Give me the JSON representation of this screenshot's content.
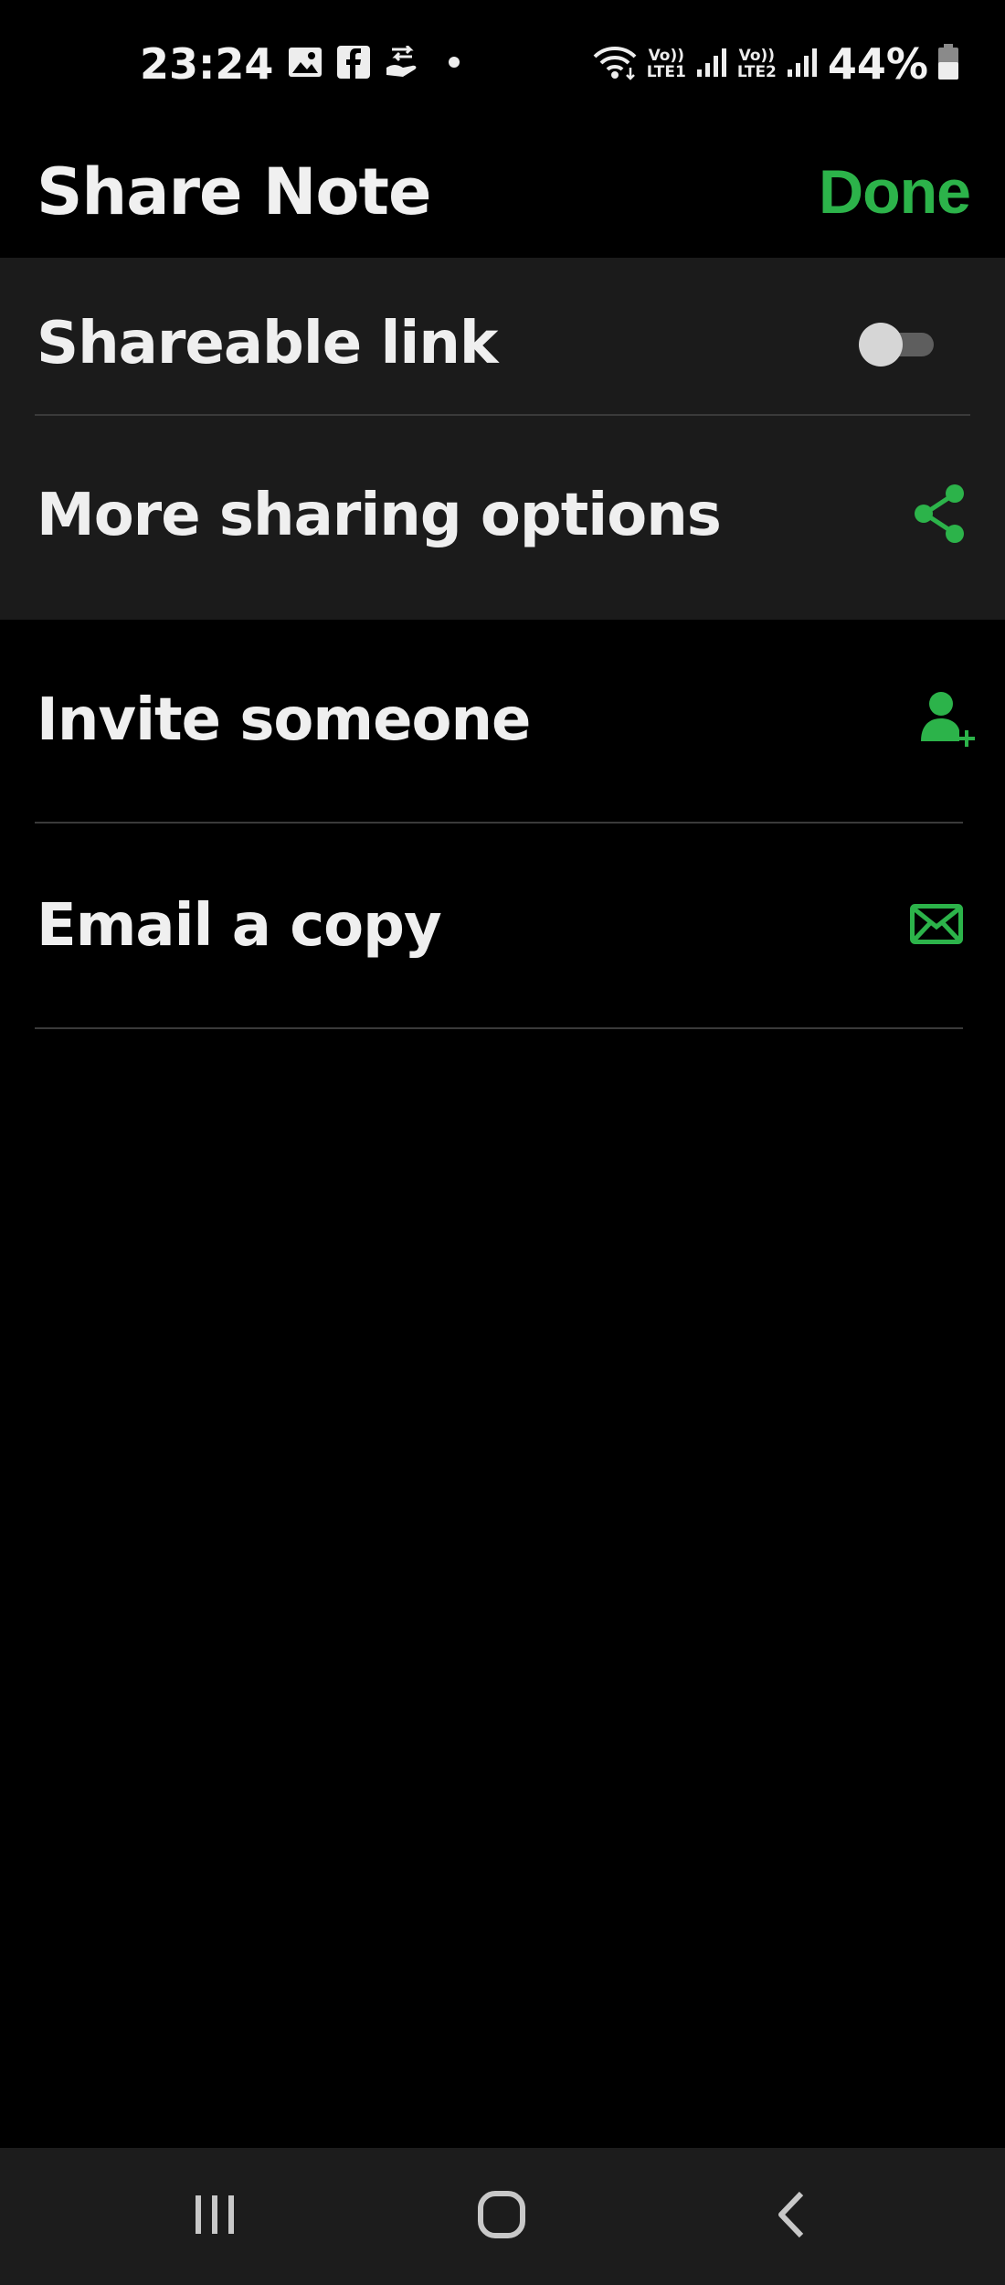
{
  "status_bar": {
    "time": "23:24",
    "network_1": {
      "top": "Vo))",
      "bottom": "LTE1"
    },
    "network_2": {
      "top": "Vo))",
      "bottom": "LTE2"
    },
    "battery": "44%",
    "icons": [
      "gallery-icon",
      "facebook-icon",
      "hand-transfer-icon",
      "dot-icon",
      "wifi-icon",
      "signal-icon",
      "battery-icon"
    ]
  },
  "header": {
    "title": "Share Note",
    "done_label": "Done"
  },
  "link_section": {
    "shareable_link_label": "Shareable link",
    "shareable_link_enabled": false,
    "more_options_label": "More sharing options"
  },
  "actions": {
    "invite_label": "Invite someone",
    "email_label": "Email a copy"
  },
  "navigation": {
    "items": [
      "recent-apps-icon",
      "home-icon",
      "back-icon"
    ]
  },
  "colors": {
    "accent": "#2CB34A",
    "background": "#000000",
    "card": "#1B1B1B",
    "navbar": "#1C1C1C"
  }
}
